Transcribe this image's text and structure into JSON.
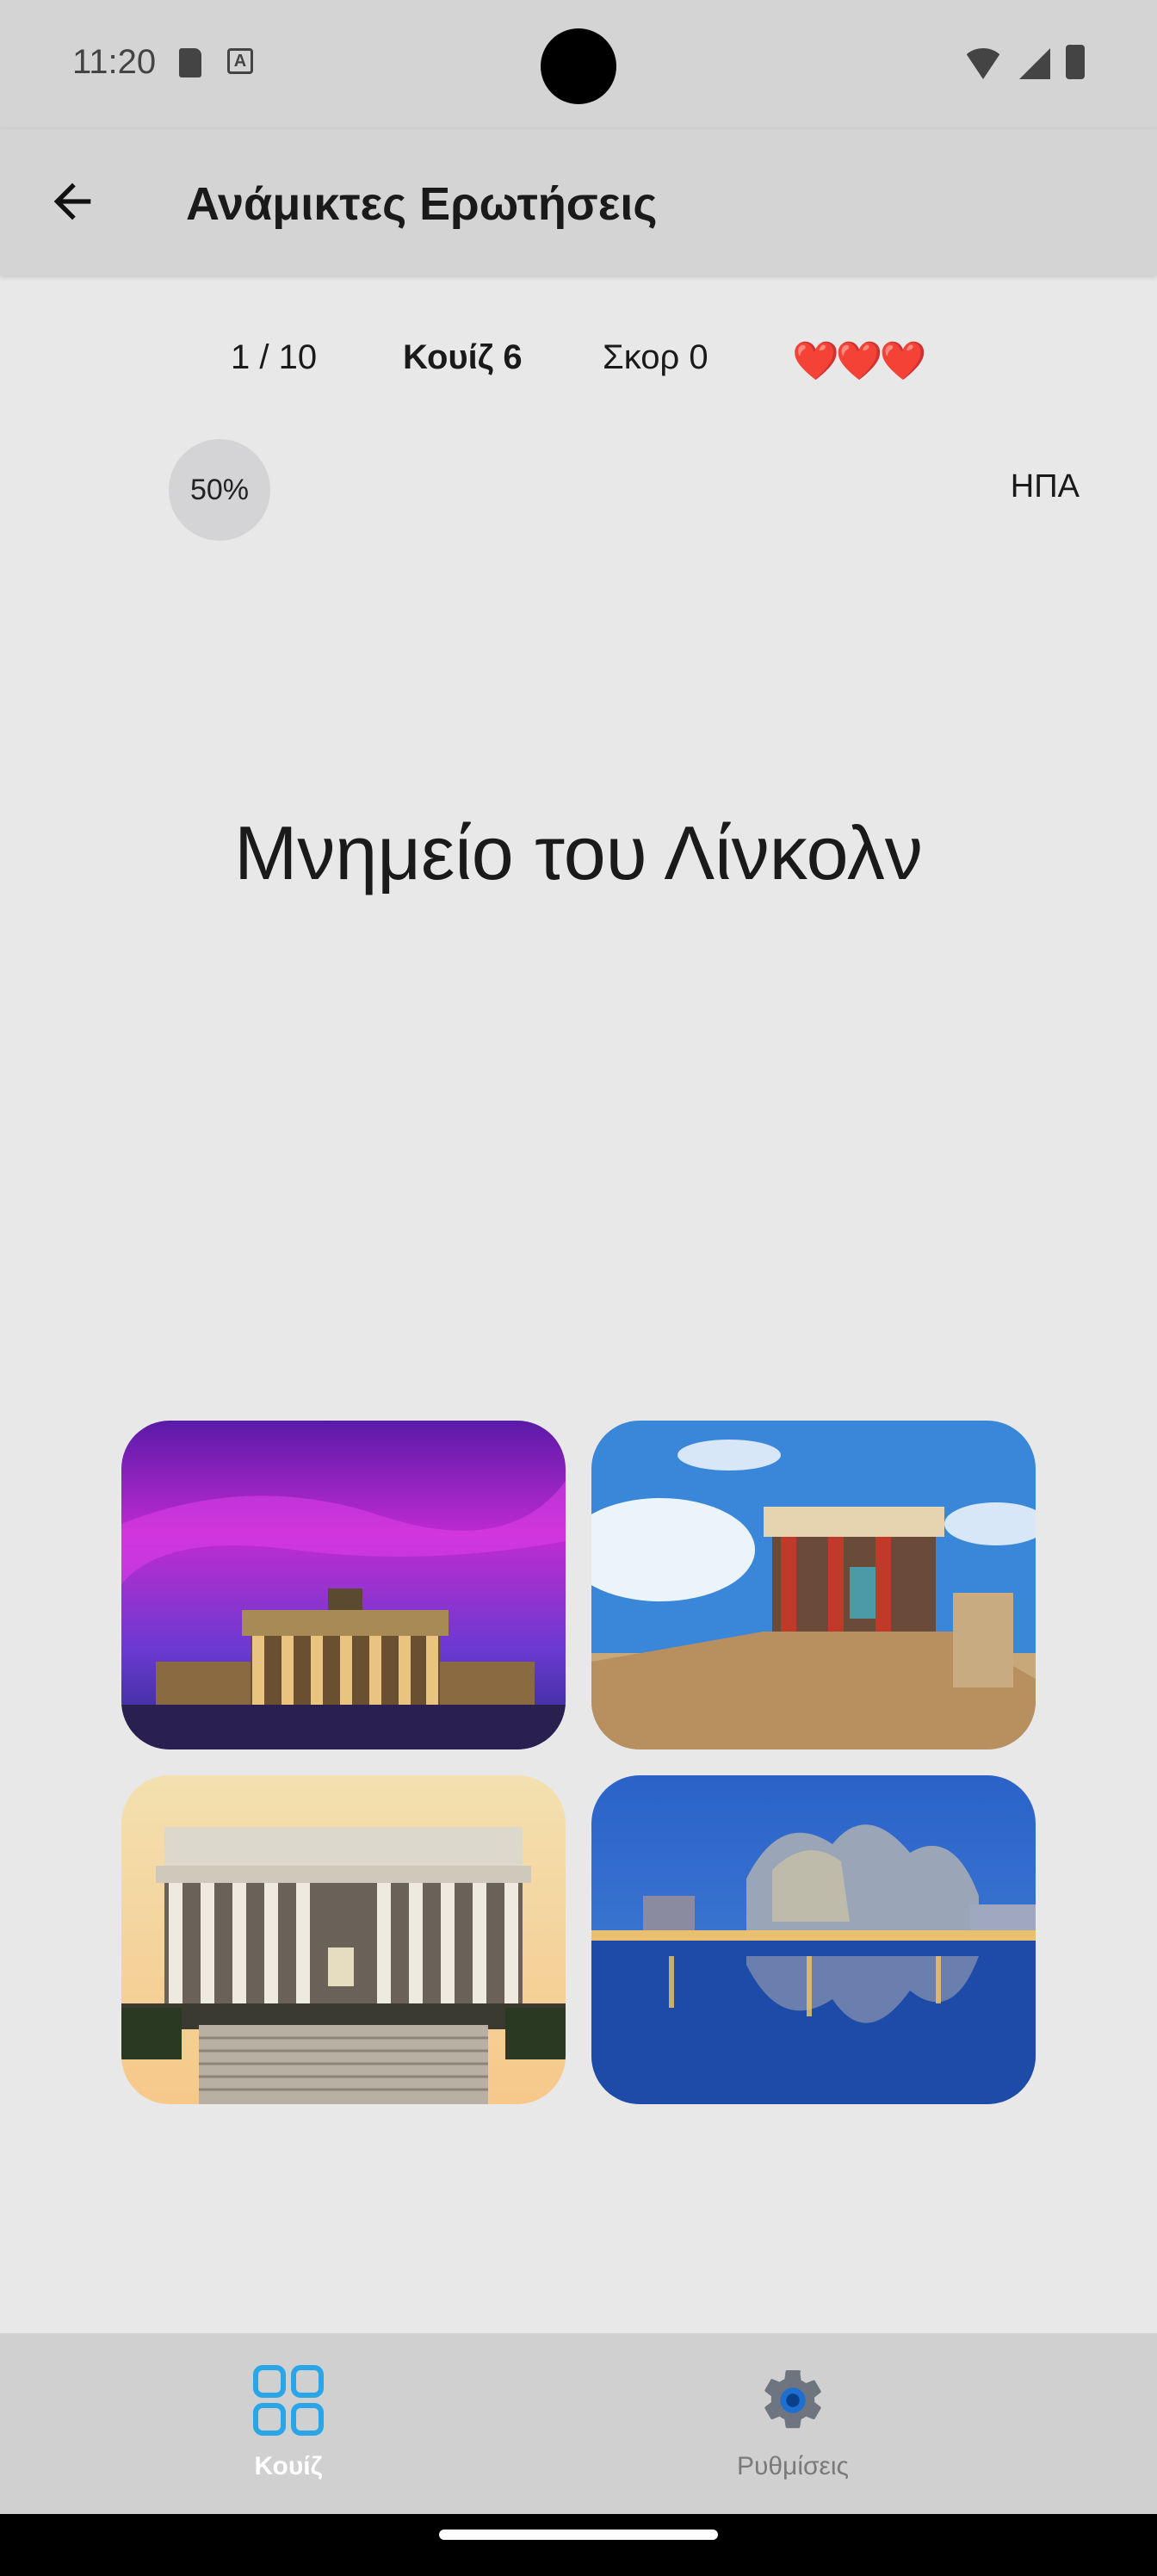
{
  "status_bar": {
    "time": "11:20",
    "icons_left": [
      "sd-card-icon",
      "accessibility-a-icon"
    ],
    "icons_right": [
      "wifi-icon",
      "cellular-icon",
      "battery-icon"
    ]
  },
  "app_bar": {
    "back_icon": "arrow-left-icon",
    "title": "Ανάμικτες Ερωτήσεις"
  },
  "stats": {
    "progress": "1 / 10",
    "quiz": "Κουίζ 6",
    "score": "Σκορ 0",
    "hearts": "❤️❤️❤️"
  },
  "hint": {
    "percent": "50%",
    "country": "ΗΠΑ"
  },
  "question": "Μνημείο του Λίνκολν",
  "answers": [
    {
      "scene": "brandenburg-gate-purple-sky"
    },
    {
      "scene": "knossos-palace-ruins"
    },
    {
      "scene": "lincoln-memorial"
    },
    {
      "scene": "guggenheim-bilbao-night"
    }
  ],
  "bottom_nav": {
    "items": [
      {
        "label": "Κουίζ",
        "icon": "grid-icon",
        "active": true
      },
      {
        "label": "Ρυθμίσεις",
        "icon": "gear-icon",
        "active": false
      }
    ],
    "active_color": "#2aa6e8",
    "inactive_color": "#7a7a7a"
  }
}
